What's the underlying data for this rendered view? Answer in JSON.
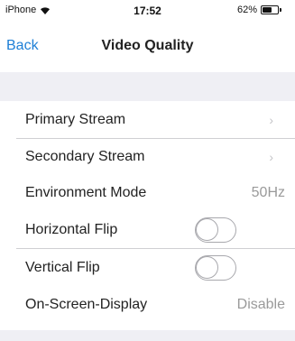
{
  "status_bar": {
    "carrier": "iPhone",
    "time": "17:52",
    "battery_percent_label": "62%",
    "battery_level": 0.62
  },
  "nav": {
    "back_label": "Back",
    "title": "Video Quality"
  },
  "rows": [
    {
      "label": "Primary Stream",
      "type": "disclosure",
      "chevron": "›"
    },
    {
      "label": "Secondary Stream",
      "type": "disclosure",
      "chevron": "›"
    },
    {
      "label": "Environment Mode",
      "type": "value",
      "value": "50Hz"
    },
    {
      "label": "Horizontal Flip",
      "type": "toggle",
      "on": false
    },
    {
      "label": "Vertical Flip",
      "type": "toggle",
      "on": false
    },
    {
      "label": "On-Screen-Display",
      "type": "value",
      "value": "Disable"
    }
  ],
  "colors": {
    "accent": "#1e7fd6",
    "section_background": "#efeff4",
    "secondary_text": "#9a9a9a"
  }
}
